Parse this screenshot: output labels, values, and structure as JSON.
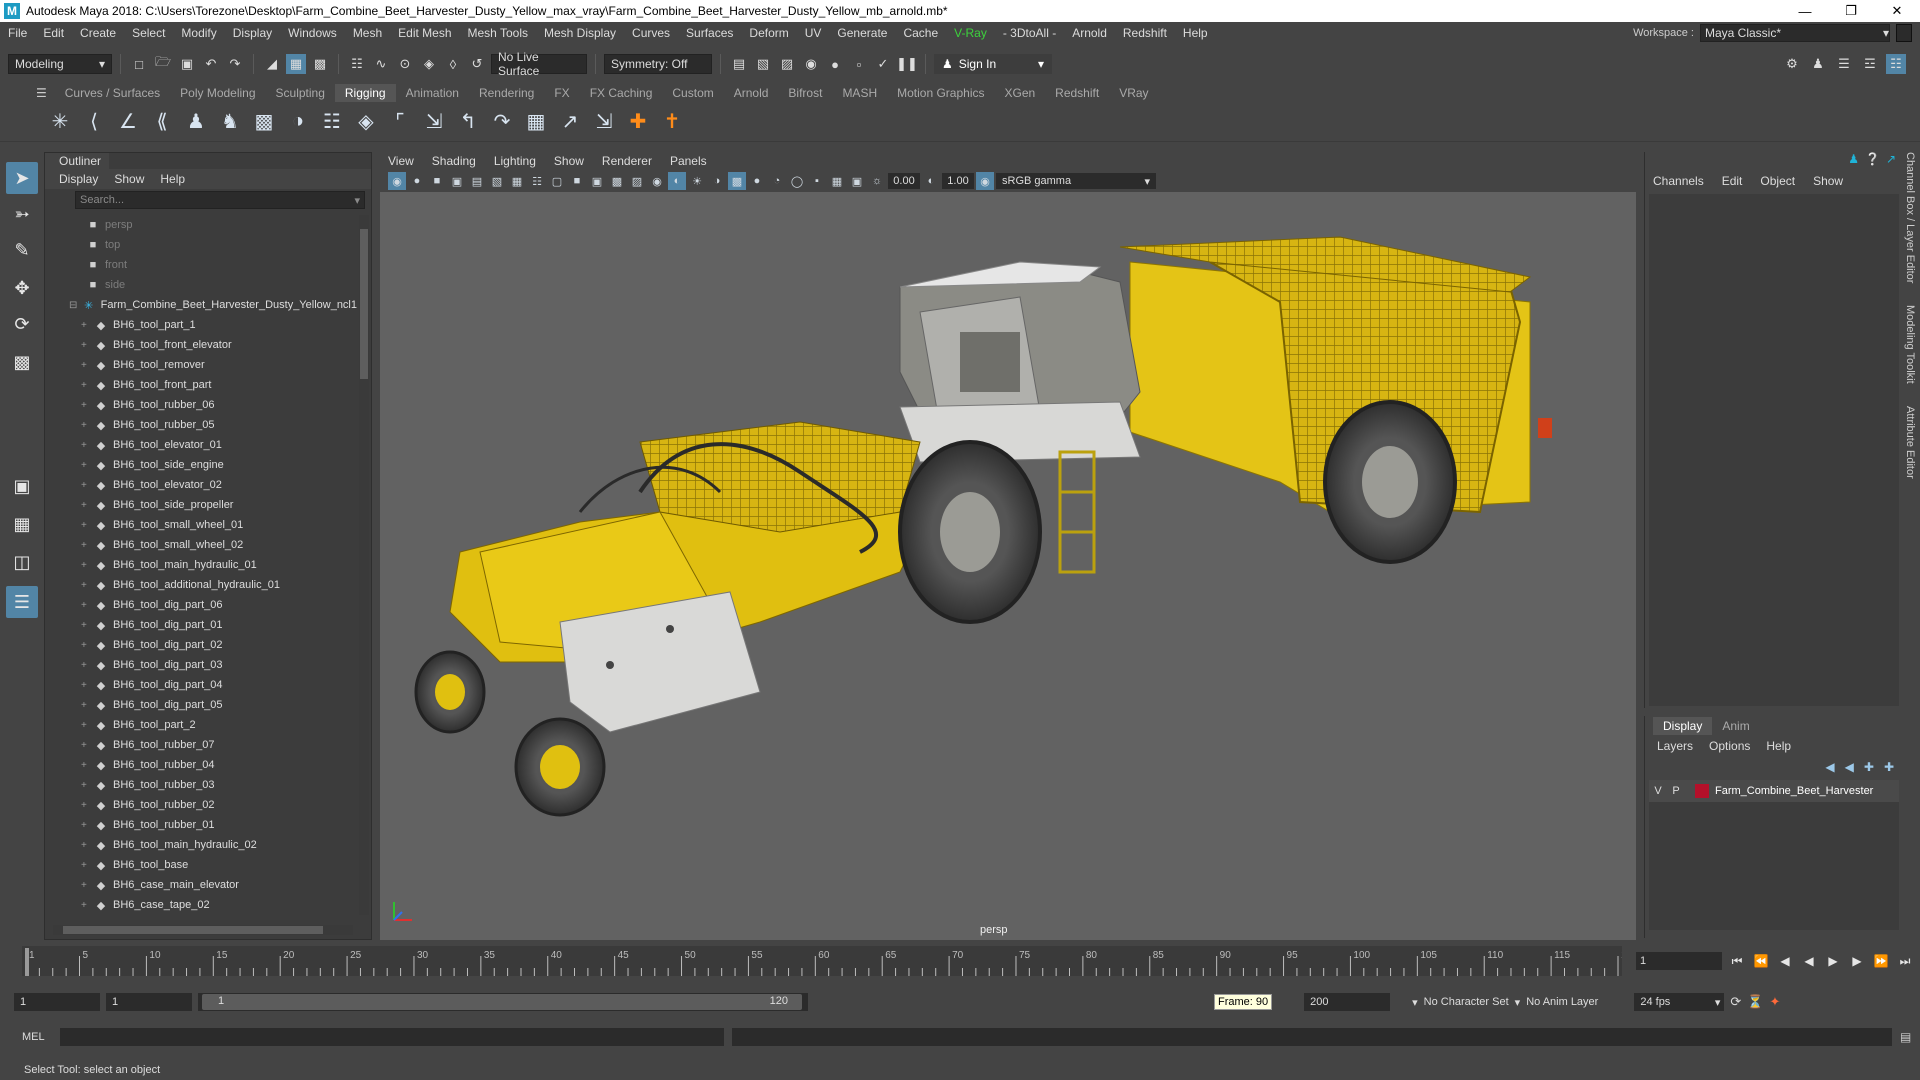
{
  "window": {
    "title": "Autodesk Maya 2018: C:\\Users\\Torezone\\Desktop\\Farm_Combine_Beet_Harvester_Dusty_Yellow_max_vray\\Farm_Combine_Beet_Harvester_Dusty_Yellow_mb_arnold.mb*",
    "logo": "M"
  },
  "menubar": {
    "items": [
      "File",
      "Edit",
      "Create",
      "Select",
      "Modify",
      "Display",
      "Windows",
      "Mesh",
      "Edit Mesh",
      "Mesh Tools",
      "Mesh Display",
      "Curves",
      "Surfaces",
      "Deform",
      "UV",
      "Generate",
      "Cache",
      "V-Ray",
      "- 3DtoAll -",
      "Arnold",
      "Redshift",
      "Help"
    ],
    "workspace_label": "Workspace :",
    "workspace_value": "Maya Classic*"
  },
  "statusline": {
    "mode": "Modeling",
    "live_surface": "No Live Surface",
    "symmetry": "Symmetry: Off",
    "sign_in": "Sign In"
  },
  "shelf": {
    "tabs": [
      "Curves / Surfaces",
      "Poly Modeling",
      "Sculpting",
      "Rigging",
      "Animation",
      "Rendering",
      "FX",
      "FX Caching",
      "Custom",
      "Arnold",
      "Bifrost",
      "MASH",
      "Motion Graphics",
      "XGen",
      "Redshift",
      "VRay"
    ],
    "active_tab": "Rigging"
  },
  "outliner": {
    "title": "Outliner",
    "menu": [
      "Display",
      "Show",
      "Help"
    ],
    "search_placeholder": "Search...",
    "cameras": [
      "persp",
      "top",
      "front",
      "side"
    ],
    "group": "Farm_Combine_Beet_Harvester_Dusty_Yellow_ncl1",
    "children": [
      "BH6_tool_part_1",
      "BH6_tool_front_elevator",
      "BH6_tool_remover",
      "BH6_tool_front_part",
      "BH6_tool_rubber_06",
      "BH6_tool_rubber_05",
      "BH6_tool_elevator_01",
      "BH6_tool_side_engine",
      "BH6_tool_elevator_02",
      "BH6_tool_side_propeller",
      "BH6_tool_small_wheel_01",
      "BH6_tool_small_wheel_02",
      "BH6_tool_main_hydraulic_01",
      "BH6_tool_additional_hydraulic_01",
      "BH6_tool_dig_part_06",
      "BH6_tool_dig_part_01",
      "BH6_tool_dig_part_02",
      "BH6_tool_dig_part_03",
      "BH6_tool_dig_part_04",
      "BH6_tool_dig_part_05",
      "BH6_tool_part_2",
      "BH6_tool_rubber_07",
      "BH6_tool_rubber_04",
      "BH6_tool_rubber_03",
      "BH6_tool_rubber_02",
      "BH6_tool_rubber_01",
      "BH6_tool_main_hydraulic_02",
      "BH6_tool_base",
      "BH6_case_main_elevator",
      "BH6_case_tape_02"
    ]
  },
  "viewport": {
    "menu": [
      "View",
      "Shading",
      "Lighting",
      "Show",
      "Renderer",
      "Panels"
    ],
    "exposure": "0.00",
    "gamma": "1.00",
    "color_space": "sRGB gamma",
    "camera_label": "persp"
  },
  "channelbox": {
    "menu": [
      "Channels",
      "Edit",
      "Object",
      "Show"
    ],
    "side_tabs": [
      "Channel Box / Layer Editor",
      "Modeling Toolkit",
      "Attribute Editor"
    ]
  },
  "layereditor": {
    "tabs": [
      "Display",
      "Anim"
    ],
    "active_tab": "Display",
    "menu": [
      "Layers",
      "Options",
      "Help"
    ],
    "layer": {
      "v": "V",
      "p": "P",
      "name": "Farm_Combine_Beet_Harvester"
    }
  },
  "timeslider": {
    "start": 1,
    "end": 120,
    "step": 5,
    "current_frame_field": "1"
  },
  "range": {
    "start_field": "1",
    "playback_start": "1",
    "range_start": "1",
    "range_end": "120",
    "frame_tip": "Frame: 90",
    "end_field": "200",
    "character_set": "No Character Set",
    "anim_layer": "No Anim Layer",
    "fps": "24 fps"
  },
  "cmdline": {
    "label": "MEL"
  },
  "helpline": {
    "text": "Select Tool: select an object"
  },
  "colors": {
    "accent": "#5285a6",
    "vray": "#3dd13d",
    "layer": "#b4102a",
    "harvester": "#e6c413"
  }
}
